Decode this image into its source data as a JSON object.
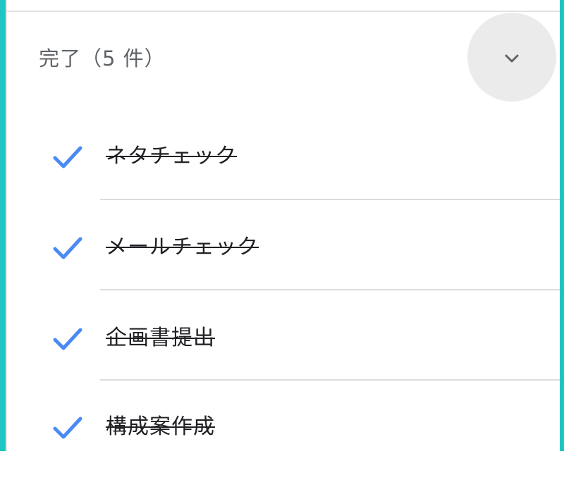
{
  "completed_section": {
    "header": "完了（5 件）",
    "toggle_icon": "chevron-down-icon"
  },
  "tasks": [
    {
      "label": "ネタチェック",
      "completed": true
    },
    {
      "label": "メールチェック",
      "completed": true
    },
    {
      "label": "企画書提出",
      "completed": true
    },
    {
      "label": "構成案作成",
      "completed": true
    }
  ],
  "colors": {
    "accent": "#4a8af4",
    "frame": "#1fc5c0",
    "header_text": "#5f6368",
    "task_text": "#202124"
  }
}
